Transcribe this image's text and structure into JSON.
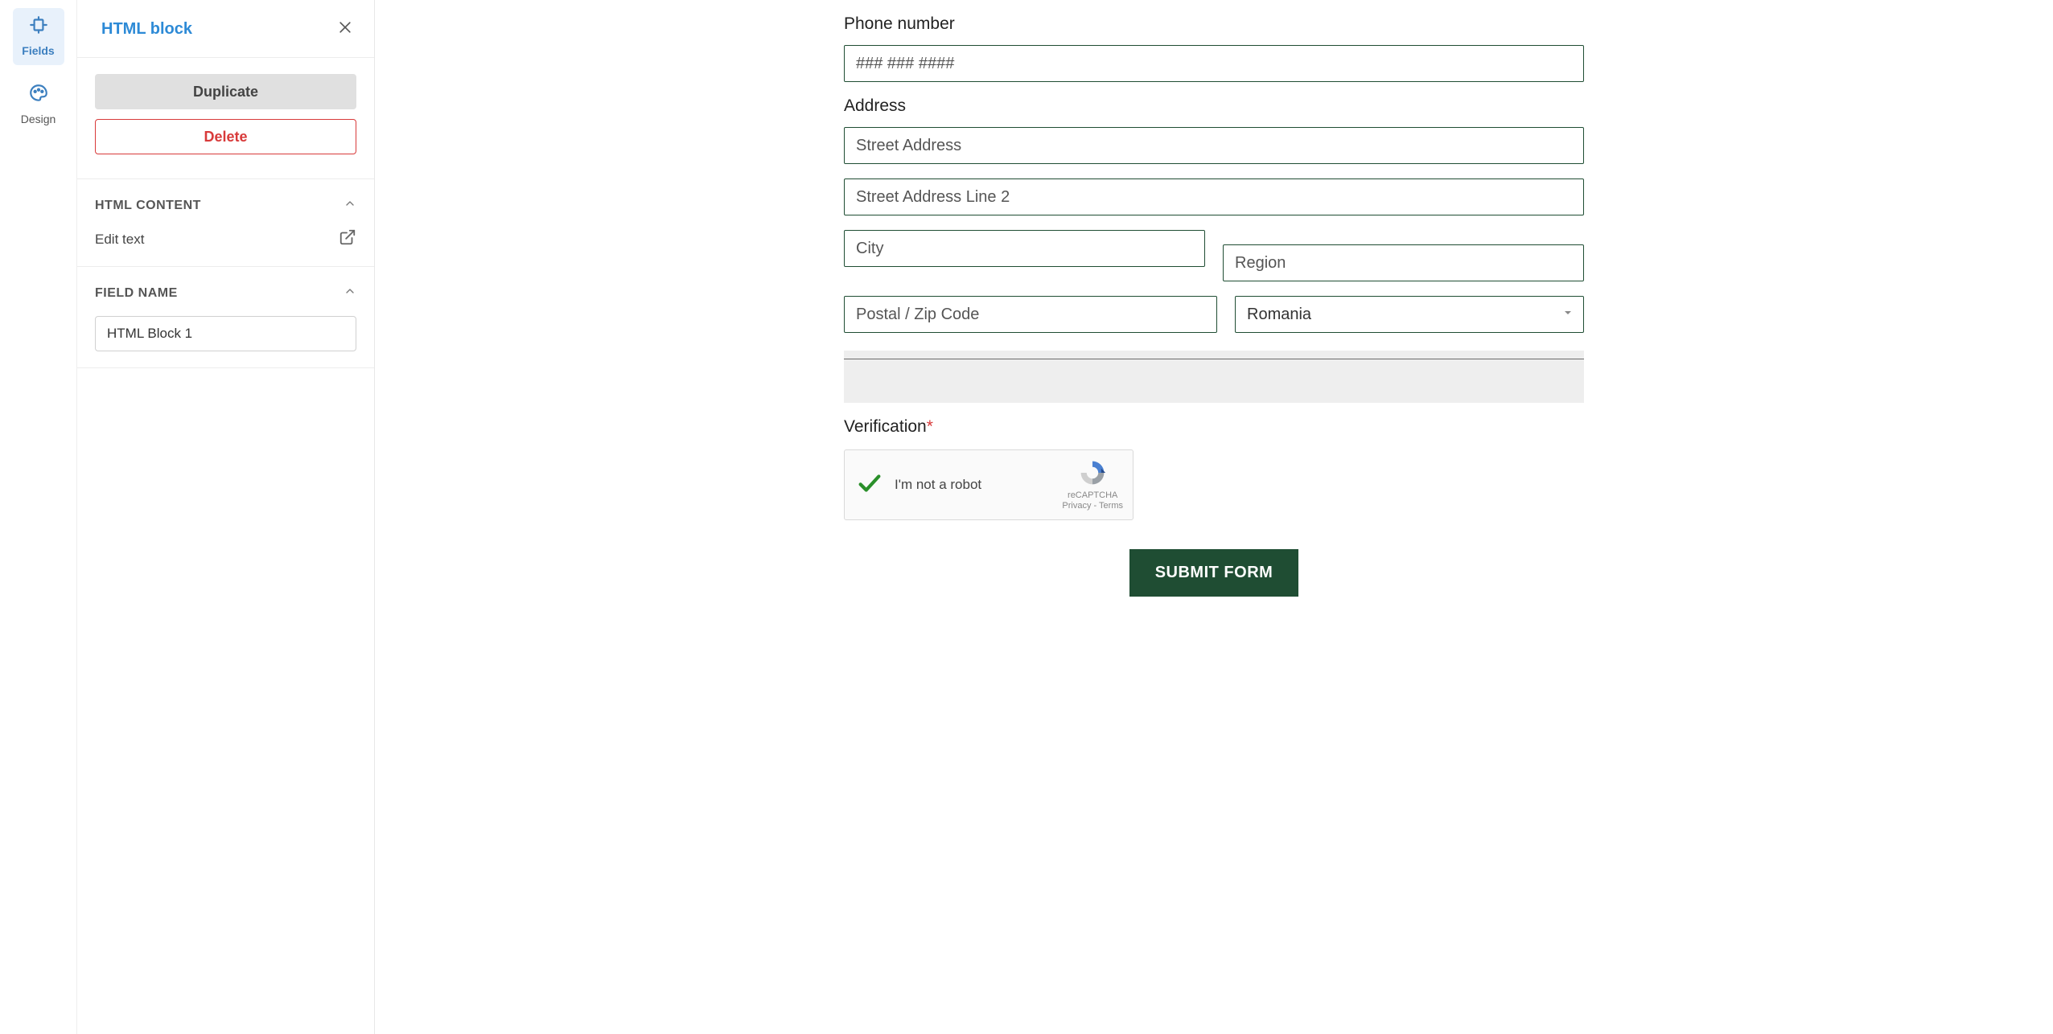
{
  "rail": {
    "fields_label": "Fields",
    "design_label": "Design"
  },
  "panel": {
    "title": "HTML block",
    "duplicate": "Duplicate",
    "delete": "Delete",
    "section_html_content": "HTML CONTENT",
    "edit_text": "Edit text",
    "section_field_name": "FIELD NAME",
    "field_name_value": "HTML Block 1"
  },
  "form": {
    "phone_label": "Phone number",
    "phone_placeholder": "### ### ####",
    "address_label": "Address",
    "street1_placeholder": "Street Address",
    "street2_placeholder": "Street Address Line 2",
    "city_placeholder": "City",
    "region_placeholder": "Region",
    "postal_placeholder": "Postal / Zip Code",
    "country_value": "Romania",
    "verification_label": "Verification",
    "captcha_text": "I'm not a robot",
    "captcha_brand": "reCAPTCHA",
    "captcha_links": "Privacy - Terms",
    "submit": "SUBMIT FORM"
  }
}
